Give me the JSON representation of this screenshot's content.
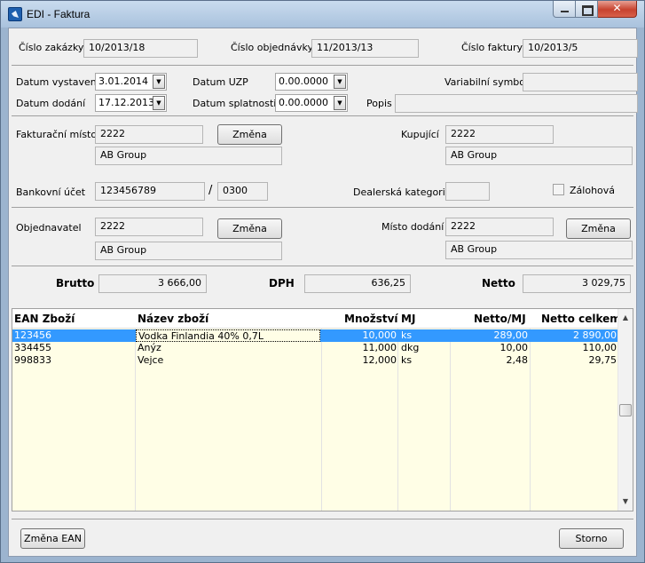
{
  "window": {
    "title": "EDI - Faktura",
    "minimize_label": "",
    "maximize_label": "",
    "close_label": ""
  },
  "header": {
    "cislo_zakazky_label": "Číslo zakázky",
    "cislo_zakazky_value": "10/2013/18",
    "cislo_objednavky_label": "Číslo objednávky",
    "cislo_objednavky_value": "11/2013/13",
    "cislo_faktury_label": "Číslo faktury",
    "cislo_faktury_value": "10/2013/5"
  },
  "dates": {
    "datum_vystaveni_label": "Datum vystavení",
    "datum_vystaveni_value": "3.01.2014",
    "datum_uzp_label": "Datum UZP",
    "datum_uzp_value": "0.00.0000",
    "variabilni_symbol_label": "Variabilní symbol",
    "variabilni_symbol_value": "",
    "datum_dodani_label": "Datum dodání",
    "datum_dodani_value": "17.12.2013",
    "datum_splatnosti_label": "Datum splatnosti",
    "datum_splatnosti_value": "0.00.0000",
    "popis_label": "Popis",
    "popis_value": ""
  },
  "parties": {
    "fakturacni_misto_label": "Fakturační místo",
    "fakturacni_misto_code": "2222",
    "fakturacni_misto_name": "AB Group",
    "zmena_label": "Změna",
    "kupujici_label": "Kupující",
    "kupujici_code": "2222",
    "kupujici_name": "AB Group",
    "bankovni_ucet_label": "Bankovní účet",
    "bankovni_ucet_number": "123456789",
    "slash": "/",
    "bankovni_ucet_bank": "0300",
    "dealerska_kategorie_label": "Dealerská kategorie",
    "dealerska_kategorie_value": "",
    "zalohova_label": "Zálohová",
    "zalohova_checked": false,
    "objednavatel_label": "Objednavatel",
    "objednavatel_code": "2222",
    "objednavatel_name": "AB Group",
    "misto_dodani_label": "Místo dodání",
    "misto_dodani_code": "2222",
    "misto_dodani_name": "AB Group"
  },
  "totals": {
    "brutto_label": "Brutto",
    "brutto_value": "3 666,00",
    "dph_label": "DPH",
    "dph_value": "636,25",
    "netto_label": "Netto",
    "netto_value": "3 029,75"
  },
  "grid": {
    "columns": [
      "EAN Zboží",
      "Název zboží",
      "Množství",
      "MJ",
      "Netto/MJ",
      "Netto celkem"
    ],
    "rows": [
      [
        "123456",
        "Vodka Finlandia 40% 0,7L",
        "10,000",
        "ks",
        "289,00",
        "2 890,00"
      ],
      [
        "334455",
        "Anýz",
        "11,000",
        "dkg",
        "10,00",
        "110,00"
      ],
      [
        "998833",
        "Vejce",
        "12,000",
        "ks",
        "2,48",
        "29,75"
      ]
    ],
    "selected_row": 0
  },
  "footer": {
    "zmena_ean_label": "Změna EAN",
    "storno_label": "Storno"
  }
}
